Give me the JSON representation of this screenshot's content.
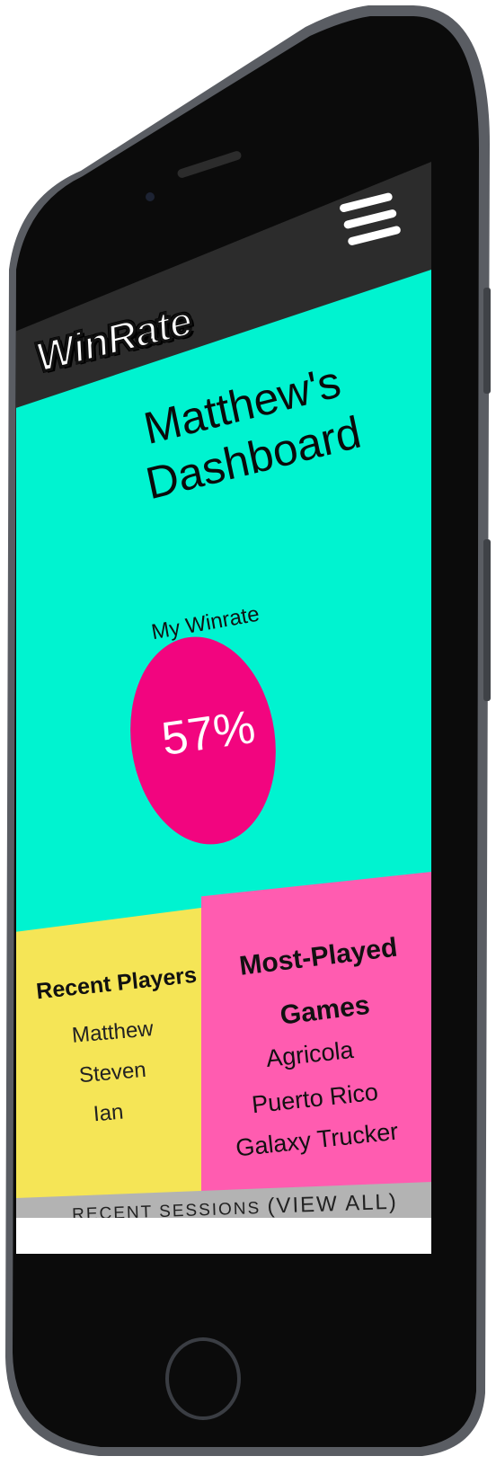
{
  "app": {
    "logo_text": "WinRate",
    "menu_icon": "hamburger-icon"
  },
  "dashboard": {
    "title_line1": "Matthew's",
    "title_line2": "Dashboard",
    "winrate_label": "My Winrate",
    "winrate_value": "57%"
  },
  "recent_players": {
    "title": "Recent Players",
    "items": [
      "Matthew",
      "Steven",
      "Ian"
    ]
  },
  "most_played": {
    "title_line1": "Most-Played",
    "title_line2": "Games",
    "items": [
      "Agricola",
      "Puerto Rico",
      "Galaxy Trucker"
    ]
  },
  "sessions": {
    "label": "RECENT SESSIONS",
    "view_all": "(VIEW ALL)"
  },
  "colors": {
    "hero": "#00f3d0",
    "winrate_circle": "#f2057f",
    "players_panel": "#f5e556",
    "games_panel": "#ff5cb0",
    "topbar": "#2c2c2c"
  }
}
